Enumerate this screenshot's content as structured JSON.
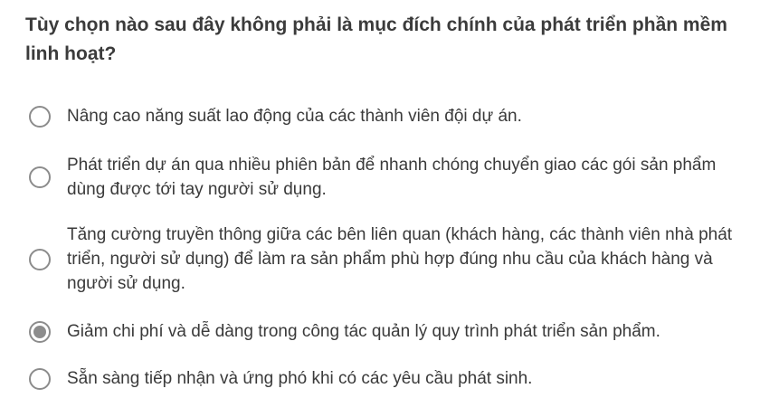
{
  "question": {
    "text": "Tùy chọn nào sau đây không phải là mục đích chính của phát triển phần mềm linh hoạt?"
  },
  "options": [
    {
      "label": "Nâng cao năng suất lao động của các thành viên đội dự án.",
      "selected": false
    },
    {
      "label": "Phát triển dự án qua nhiều phiên bản để nhanh chóng chuyển giao các gói sản phẩm dùng được tới tay người sử dụng.",
      "selected": false
    },
    {
      "label": "Tăng cường truyền thông giữa các bên liên quan (khách hàng, các thành viên nhà phát triển, người sử dụng) để làm ra sản phẩm phù hợp đúng nhu cầu của khách hàng và người sử dụng.",
      "selected": false
    },
    {
      "label": "Giảm chi phí và dễ dàng trong công tác quản lý quy trình phát triển sản phẩm.",
      "selected": true
    },
    {
      "label": "Sẵn sàng tiếp nhận và ứng phó khi có các yêu cầu phát sinh.",
      "selected": false
    }
  ],
  "colors": {
    "radio_border": "#8c8c8c",
    "text": "#3a3a3a"
  }
}
